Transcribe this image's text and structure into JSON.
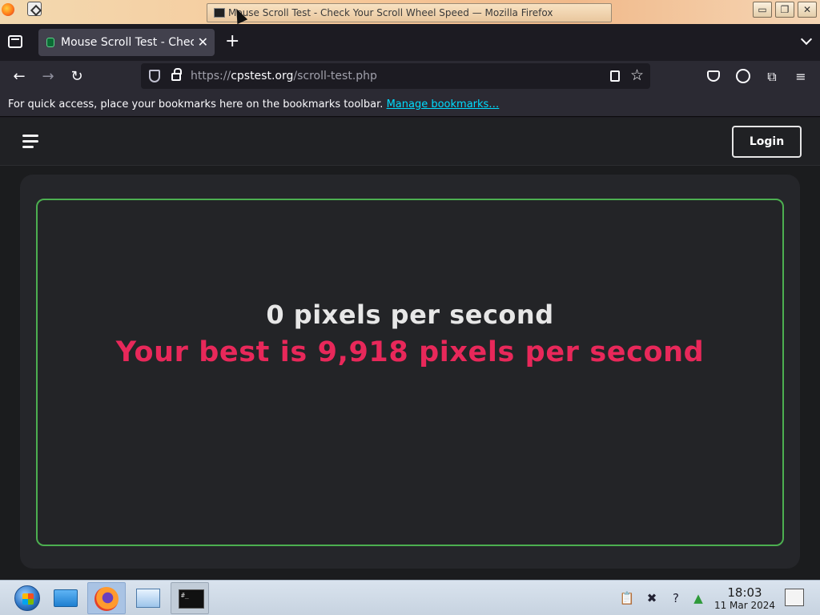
{
  "window": {
    "title": "Mouse Scroll Test - Check Your Scroll Wheel Speed — Mozilla Firefox",
    "controls": [
      "minimize",
      "maximize",
      "close"
    ]
  },
  "browser": {
    "tab": {
      "label": "Mouse Scroll Test - Check Your Scroll Wheel Speed",
      "close_glyph": "✕"
    },
    "new_tab_glyph": "+",
    "url": {
      "scheme": "https://",
      "host": "cpstest.org",
      "path": "/scroll-test.php"
    },
    "bookmarks_bar": {
      "message": "For quick access, place your bookmarks here on the bookmarks toolbar.",
      "link": "Manage bookmarks…"
    }
  },
  "site": {
    "login_label": "Login",
    "speed_text": "0 pixels per second",
    "best_text": "Your best is 9,918 pixels per second",
    "colors": {
      "accent_border": "#4caf50",
      "best_color": "#e8285a"
    }
  },
  "taskbar": {
    "time": "18:03",
    "date": "11 Mar 2024",
    "terminal_label": "#_"
  }
}
